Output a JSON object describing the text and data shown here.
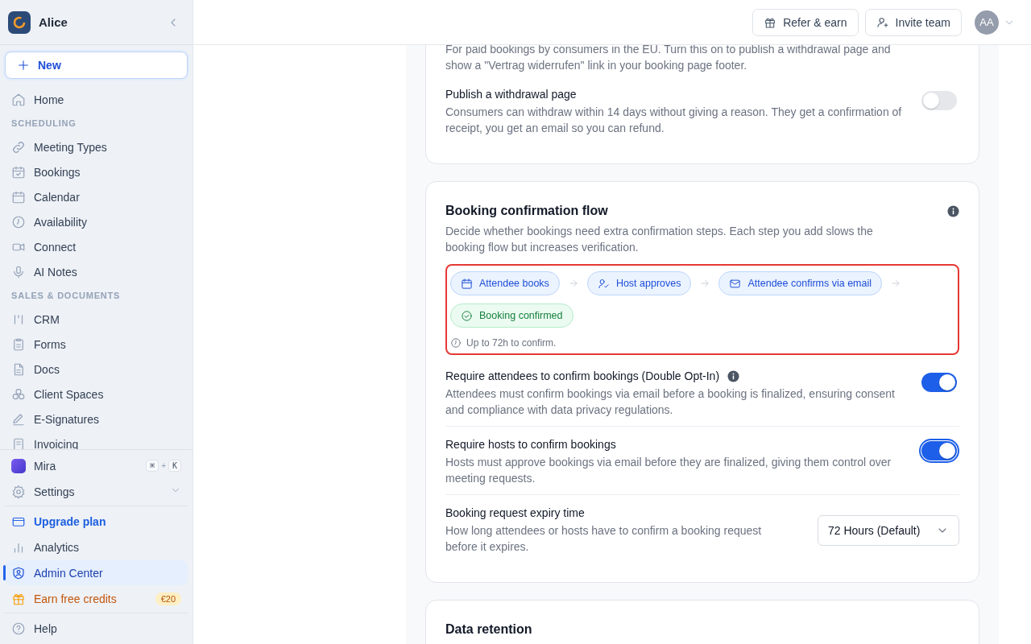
{
  "sidebar": {
    "workspace": "Alice",
    "new_button": "New",
    "nav": [
      {
        "kind": "item",
        "label": "Home",
        "selected": false
      },
      {
        "kind": "section",
        "label": "SCHEDULING"
      },
      {
        "kind": "item",
        "label": "Meeting Types",
        "selected": false
      },
      {
        "kind": "item",
        "label": "Bookings",
        "selected": false
      },
      {
        "kind": "item",
        "label": "Calendar",
        "selected": false
      },
      {
        "kind": "item",
        "label": "Availability",
        "selected": false
      },
      {
        "kind": "item",
        "label": "Connect",
        "selected": false
      },
      {
        "kind": "item",
        "label": "AI Notes",
        "selected": false
      },
      {
        "kind": "section",
        "label": "SALES & DOCUMENTS"
      },
      {
        "kind": "item",
        "label": "CRM",
        "selected": false
      },
      {
        "kind": "item",
        "label": "Forms",
        "selected": false
      },
      {
        "kind": "item",
        "label": "Docs",
        "selected": false
      },
      {
        "kind": "item",
        "label": "Client Spaces",
        "selected": false
      },
      {
        "kind": "item",
        "label": "E-Signatures",
        "selected": false
      },
      {
        "kind": "item",
        "label": "Invoicing"
      }
    ],
    "bottom": [
      {
        "kind": "mira",
        "label": "Mira",
        "shortcut": [
          {
            "kind": "key",
            "text": "⌘"
          },
          {
            "kind": "plus",
            "text": "+"
          },
          {
            "kind": "key",
            "text": "K"
          }
        ]
      },
      {
        "kind": "expandable",
        "label": "Settings",
        "expanded": false
      },
      {
        "kind": "divider"
      },
      {
        "kind": "upgrade",
        "label": "Upgrade plan",
        "selected": false
      },
      {
        "kind": "item",
        "label": "Analytics",
        "selected": false
      },
      {
        "kind": "item",
        "label": "Admin Center",
        "selected": true
      },
      {
        "kind": "credits",
        "label": "Earn free credits",
        "badge": "€20",
        "selected": false
      },
      {
        "kind": "divider"
      },
      {
        "kind": "item",
        "label": "Help",
        "selected": false
      }
    ]
  },
  "header": {
    "buttons": [
      {
        "label": "Refer & earn"
      },
      {
        "label": "Invite team"
      }
    ],
    "avatar": "AA"
  },
  "cards": [
    {
      "description": "For paid bookings by consumers in the EU. Turn this on to publish a withdrawal page and show a \"Vertrag widerrufen\" link in your booking page footer.",
      "settings": [
        {
          "kind": "toggle",
          "title": "Publish a withdrawal page",
          "description": "Consumers can withdraw within 14 days without giving a reason. They get a confirmation of receipt, you get an email so you can refund.",
          "on": false,
          "focused": false
        }
      ]
    },
    {
      "title": "Booking confirmation flow",
      "description": "Decide whether bookings need extra confirmation steps. Each step you add slows the booking flow but increases verification.",
      "flow": {
        "highlighted": true,
        "steps": [
          {
            "kind": "step",
            "label": "Attendee books"
          },
          {
            "kind": "step",
            "label": "Host approves"
          },
          {
            "kind": "step",
            "label": "Attendee confirms via email"
          },
          {
            "kind": "done",
            "label": "Booking confirmed"
          }
        ],
        "note": "Up to 72h to confirm."
      },
      "settings": [
        {
          "kind": "toggle",
          "title": "Require attendees to confirm bookings (Double Opt-In)",
          "info": true,
          "description": "Attendees must confirm bookings via email before a booking is finalized, ensuring consent and compliance with data privacy regulations.",
          "on": true,
          "focused": false
        },
        {
          "kind": "toggle",
          "title": "Require hosts to confirm bookings",
          "info": false,
          "description": "Hosts must approve bookings via email before they are finalized, giving them control over meeting requests.",
          "on": true,
          "focused": true
        },
        {
          "kind": "select",
          "title": "Booking request expiry time",
          "description": "How long attendees or hosts have to confirm a booking request before it expires.",
          "value": "72 Hours (Default)"
        }
      ]
    },
    {
      "title": "Data retention"
    }
  ]
}
